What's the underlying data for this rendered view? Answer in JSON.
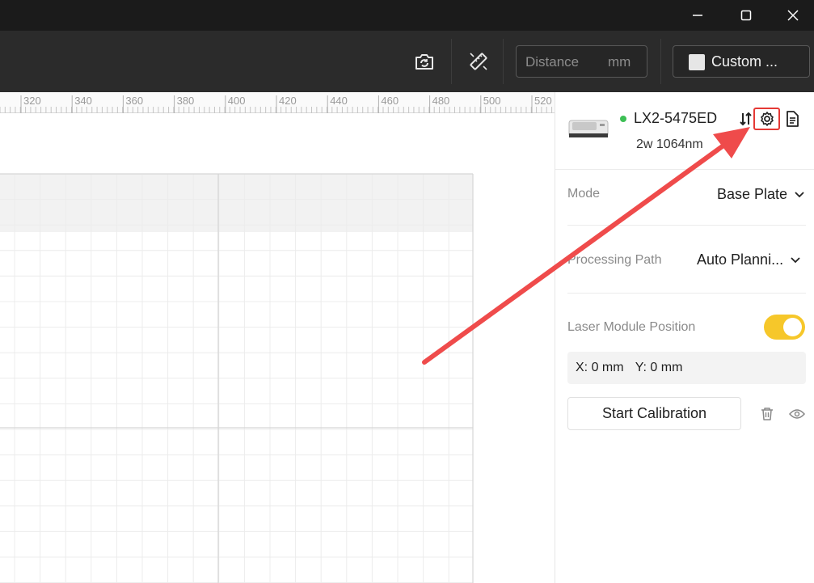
{
  "window": {
    "minimize_icon": "minimize-icon",
    "maximize_icon": "maximize-icon",
    "close_icon": "close-icon"
  },
  "toolbar": {
    "camera_icon": "camera-rotate-icon",
    "measure_icon": "measure-ruler-icon",
    "distance_placeholder": "Distance",
    "distance_unit": "mm",
    "material_label": "Custom ..."
  },
  "ruler": {
    "ticks": [
      "320",
      "340",
      "360",
      "380",
      "400",
      "420",
      "440",
      "460",
      "480",
      "500",
      "520"
    ]
  },
  "device": {
    "name": "LX2-5475ED",
    "spec": "2w 1064nm",
    "status_color": "#3dbf55",
    "sort_icon": "sort-arrows-icon",
    "settings_icon": "gear-icon",
    "document_icon": "document-icon"
  },
  "settings": {
    "mode_label": "Mode",
    "mode_value": "Base Plate",
    "path_label": "Processing Path",
    "path_value": "Auto Planni...",
    "laser_position_label": "Laser Module Position",
    "laser_position_enabled": true,
    "x_coord": "X: 0 mm",
    "y_coord": "Y: 0 mm",
    "calibration_button": "Start Calibration",
    "delete_icon": "trash-icon",
    "preview_icon": "eye-icon"
  },
  "colors": {
    "accent_toggle": "#f6c72a",
    "annotation_arrow": "#ef4b4b",
    "highlight_box": "#e53935"
  }
}
